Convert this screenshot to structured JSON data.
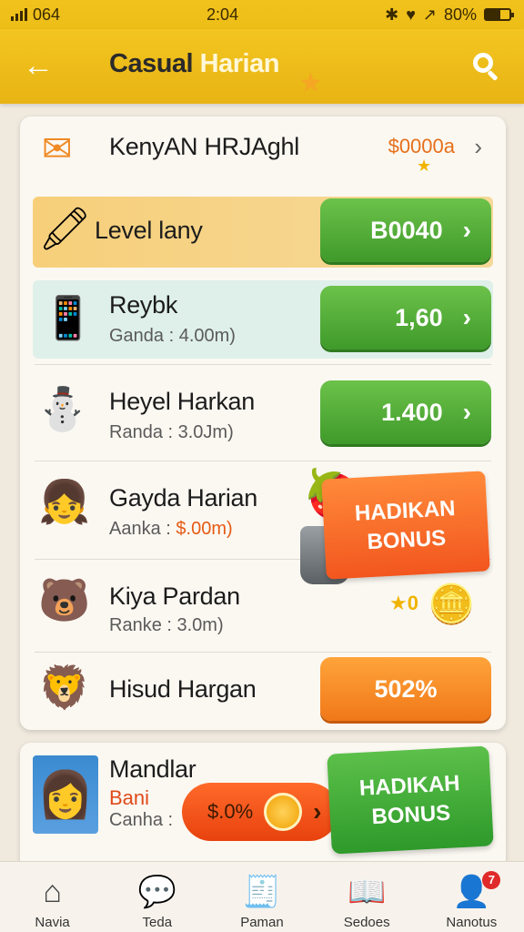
{
  "status_bar": {
    "carrier": "064",
    "time": "2:04",
    "battery": "80%"
  },
  "header": {
    "title_part1": "Casual",
    "title_part2": "Harian"
  },
  "rows": [
    {
      "name": "KenyAN HRJAghl",
      "amount": "$0000a",
      "icon": "envelope-icon"
    },
    {
      "name": "Level lany",
      "button": "B0040",
      "icon": "pencil-cup-icon"
    },
    {
      "name": "Reybk",
      "sub": "Ganda : 4.00m)",
      "button": "1,60",
      "icon": "tablet-icon"
    },
    {
      "name": "Heyel Harkan",
      "sub": "Randa : 3.0Jm)",
      "button": "1.400",
      "icon": "snowman-icon"
    },
    {
      "name": "Gayda Harian",
      "sub_label": "Aanka :",
      "sub_value": "$.00m)",
      "icon": "girl-avatar-icon"
    },
    {
      "name": "Kiya Pardan",
      "sub": "Ranke : 3.0m)",
      "icon": "bear-avatar-icon"
    },
    {
      "name": "Hisud Hargan",
      "button": "502%",
      "icon": "lion-avatar-icon"
    }
  ],
  "bonus_tag": {
    "line1": "HADIKAN",
    "line2": "BONUS"
  },
  "coin_label": "0",
  "card2": {
    "name": "Mandlar",
    "sub1": "Bani",
    "sub2": "Canha :",
    "promo": "$.0%",
    "banner_line1": "HADIKAH",
    "banner_line2": "BONUS"
  },
  "bottom_nav": [
    {
      "label": "Navia",
      "icon": "home-icon"
    },
    {
      "label": "Teda",
      "icon": "chat-icon"
    },
    {
      "label": "Paman",
      "icon": "register-icon"
    },
    {
      "label": "Sedoes",
      "icon": "book-icon"
    },
    {
      "label": "Nanotus",
      "icon": "profile-icon",
      "badge": "7"
    }
  ],
  "colors": {
    "header": "#f2c21c",
    "green": "#4aab33",
    "orange": "#f58a25"
  }
}
